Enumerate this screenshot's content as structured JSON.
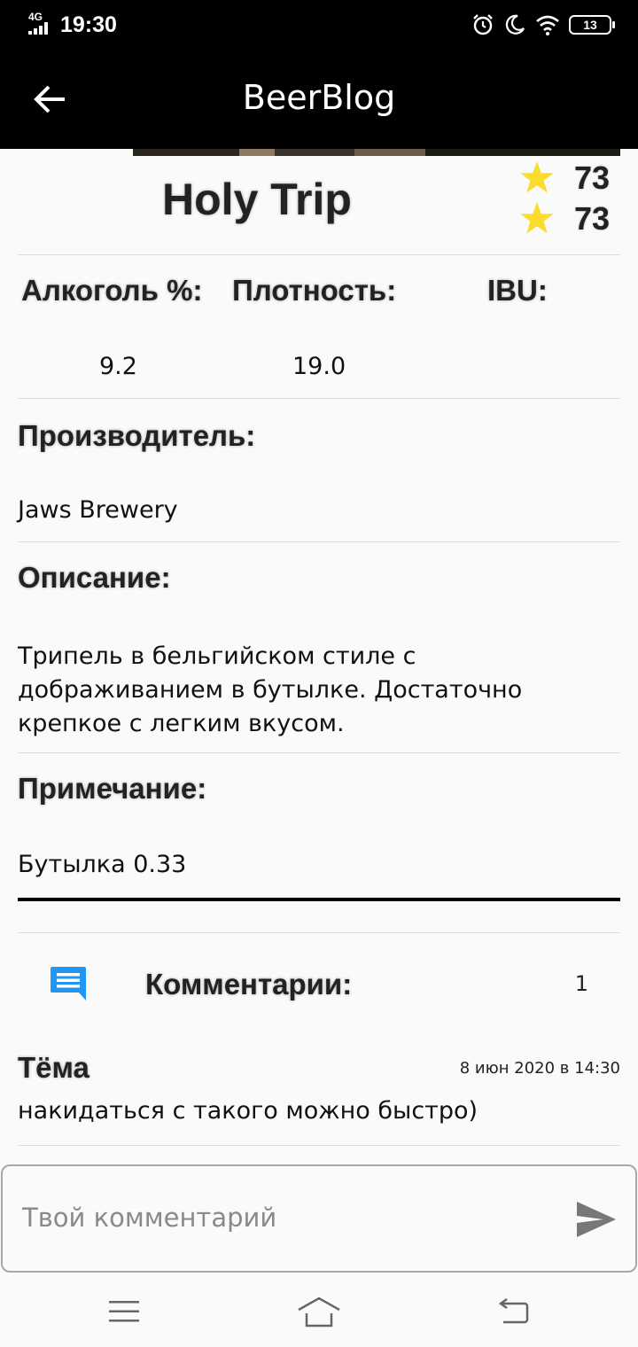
{
  "status_bar": {
    "network": "4G",
    "time": "19:30",
    "battery": "13",
    "icons": [
      "signal-icon",
      "alarm-icon",
      "moon-icon",
      "wifi-icon",
      "battery-icon"
    ]
  },
  "app_bar": {
    "title": "BeerBlog",
    "back_icon": "arrow-left-icon"
  },
  "beer": {
    "name": "Holy Trip",
    "ratings": [
      "73",
      "73"
    ],
    "stats": {
      "alcohol_label": "Алкоголь %:",
      "density_label": "Плотность:",
      "ibu_label": "IBU:",
      "alcohol_value": "9.2",
      "density_value": "19.0",
      "ibu_value": ""
    },
    "producer_label": "Производитель:",
    "producer_value": "Jaws Brewery",
    "description_label": "Описание:",
    "description_value": "Трипель в бельгийском стиле с дображиванием в бутылке. Достаточно крепкое с легким вкусом.",
    "note_label": "Примечание:",
    "note_value": "Бутылка 0.33"
  },
  "comments": {
    "title": "Комментарии:",
    "count": "1",
    "items": [
      {
        "author": "Тёма",
        "date": "8 июн 2020 в 14:30",
        "text": "накидаться с такого можно быстро)"
      }
    ]
  },
  "comment_input": {
    "placeholder": "Твой комментарий",
    "send_icon": "send-icon"
  },
  "nav_bar": {
    "icons": [
      "menu-icon",
      "home-icon",
      "back-nav-icon"
    ]
  },
  "colors": {
    "app_bar": "#000000",
    "star": "#f9dc2e",
    "comment_icon": "#2196f3",
    "background": "#fafafa"
  }
}
